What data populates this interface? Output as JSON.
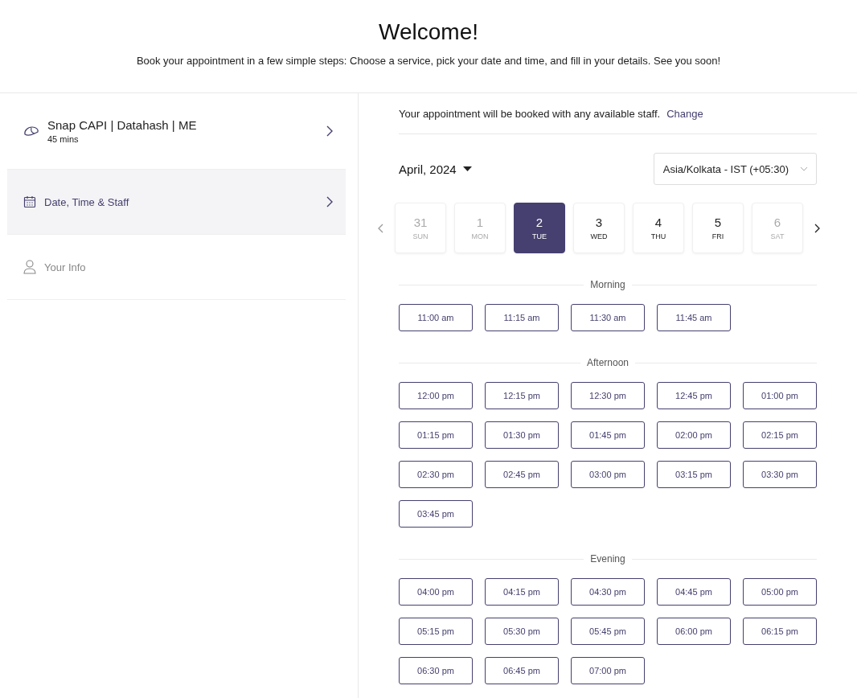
{
  "header": {
    "title": "Welcome!",
    "subtitle": "Book your appointment in a few simple steps: Choose a service, pick your date and time, and fill in your details. See you soon!"
  },
  "steps": [
    {
      "kind": "service",
      "label": "Snap CAPI | Datahash | ME",
      "detail": "45 mins",
      "selected": false,
      "disabled": false,
      "chevron": true
    },
    {
      "kind": "calendar",
      "label": "Date, Time & Staff",
      "selected": true,
      "disabled": false,
      "chevron": true
    },
    {
      "kind": "person",
      "label": "Your Info",
      "selected": false,
      "disabled": true,
      "chevron": false
    }
  ],
  "staff_note": {
    "text": "Your appointment will be booked with any available staff.",
    "link": "Change"
  },
  "month": "April, 2024",
  "timezone": "Asia/Kolkata - IST (+05:30)",
  "days": [
    {
      "day": "31",
      "weekday": "SUN",
      "selected": false,
      "disabled": true
    },
    {
      "day": "1",
      "weekday": "MON",
      "selected": false,
      "disabled": true
    },
    {
      "day": "2",
      "weekday": "TUE",
      "selected": true,
      "disabled": false
    },
    {
      "day": "3",
      "weekday": "WED",
      "selected": false,
      "disabled": false
    },
    {
      "day": "4",
      "weekday": "THU",
      "selected": false,
      "disabled": false
    },
    {
      "day": "5",
      "weekday": "FRI",
      "selected": false,
      "disabled": false
    },
    {
      "day": "6",
      "weekday": "SAT",
      "selected": false,
      "disabled": true
    }
  ],
  "slot_groups": [
    {
      "label": "Morning",
      "slots": [
        "11:00 am",
        "11:15 am",
        "11:30 am",
        "11:45 am"
      ]
    },
    {
      "label": "Afternoon",
      "slots": [
        "12:00 pm",
        "12:15 pm",
        "12:30 pm",
        "12:45 pm",
        "01:00 pm",
        "01:15 pm",
        "01:30 pm",
        "01:45 pm",
        "02:00 pm",
        "02:15 pm",
        "02:30 pm",
        "02:45 pm",
        "03:00 pm",
        "03:15 pm",
        "03:30 pm",
        "03:45 pm"
      ]
    },
    {
      "label": "Evening",
      "slots": [
        "04:00 pm",
        "04:15 pm",
        "04:30 pm",
        "04:45 pm",
        "05:00 pm",
        "05:15 pm",
        "05:30 pm",
        "05:45 pm",
        "06:00 pm",
        "06:15 pm",
        "06:30 pm",
        "06:45 pm",
        "07:00 pm"
      ]
    }
  ]
}
